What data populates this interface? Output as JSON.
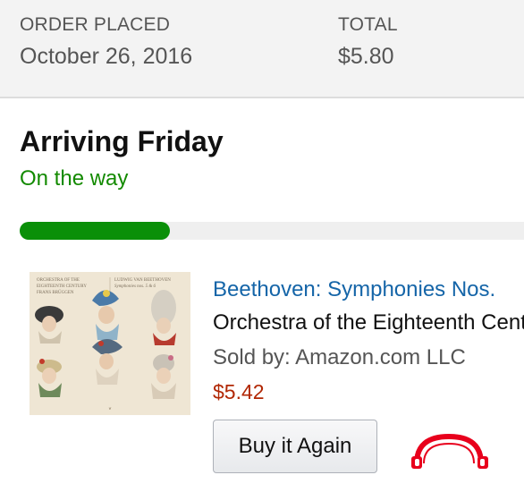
{
  "order": {
    "placed_label": "ORDER PLACED",
    "placed_date": "October 26, 2016",
    "total_label": "TOTAL",
    "total_value": "$5.80"
  },
  "shipment": {
    "arriving": "Arriving Friday",
    "status": "On the way",
    "progress": 0.29
  },
  "item": {
    "title": "Beethoven: Symphonies Nos.",
    "artist": "Orchestra of the Eighteenth Cent",
    "sold_by": "Sold by: Amazon.com LLC",
    "price": "$5.42",
    "buy_again_label": "Buy it Again",
    "cover": {
      "text_left_1": "ORCHESTRA OF THE",
      "text_left_2": "EIGHTEENTH CENTURY",
      "text_left_3": "FRANS BRÜGGEN",
      "text_right_1": "LUDWIG VAN BEETHOVEN",
      "text_right_2": "Symphonies nos. 5 & 6"
    }
  },
  "colors": {
    "link": "#1565a8",
    "status_green": "#138a00",
    "progress_green": "#0a8f08",
    "price_red": "#b12704",
    "headphones_red": "#e8001c"
  },
  "icons": {
    "headphones": "headphones-icon"
  }
}
